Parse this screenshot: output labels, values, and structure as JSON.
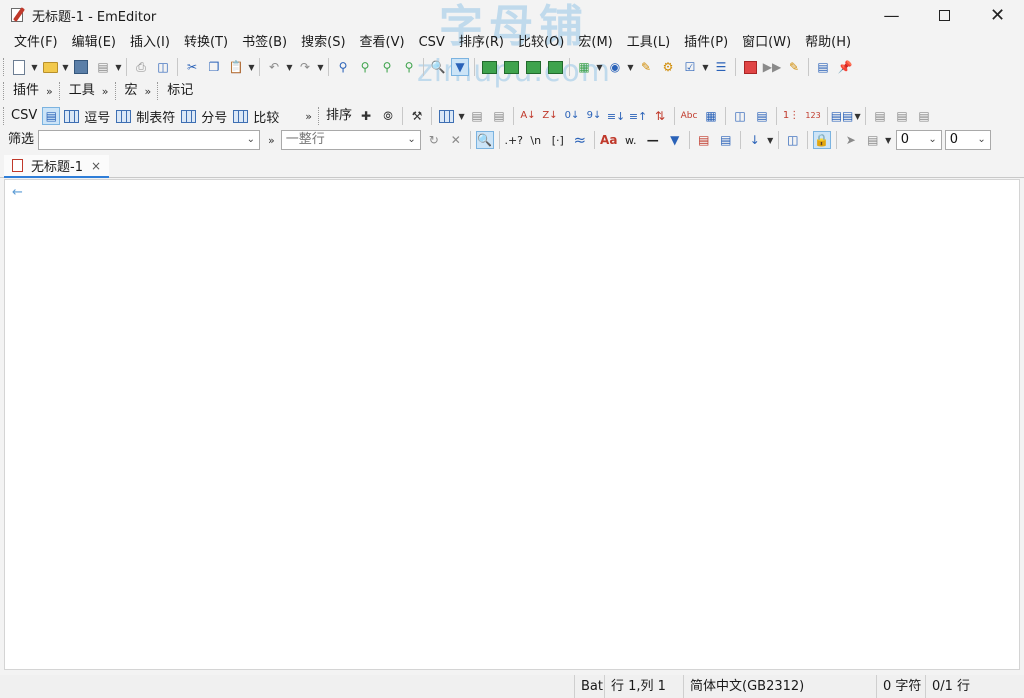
{
  "window": {
    "title": "无标题-1 - EmEditor",
    "watermark_line1": "字母铺",
    "watermark_line2": "zimupu.com"
  },
  "menu": [
    "文件(F)",
    "编辑(E)",
    "插入(I)",
    "转换(T)",
    "书签(B)",
    "搜索(S)",
    "查看(V)",
    "CSV",
    "排序(R)",
    "比较(O)",
    "宏(M)",
    "工具(L)",
    "插件(P)",
    "窗口(W)",
    "帮助(H)"
  ],
  "toolbar2": {
    "plugins": "插件",
    "tools": "工具",
    "macros": "宏",
    "marks": "标记"
  },
  "csv_toolbar": {
    "csv": "CSV",
    "comma": "逗号",
    "tab": "制表符",
    "semicolon": "分号",
    "compare": "比较",
    "sort": "排序"
  },
  "filter_toolbar": {
    "label": "筛选",
    "filter_value": "",
    "scope_value": "一整行",
    "num1": "0",
    "num2": "0"
  },
  "tab": {
    "title": "无标题-1",
    "close": "×"
  },
  "editor": {
    "eof_marker": "←"
  },
  "status": {
    "mode": "Bat",
    "position": "行 1,列 1",
    "encoding": "简体中文(GB2312)",
    "chars": "0 字符",
    "lines": "0/1 行"
  }
}
